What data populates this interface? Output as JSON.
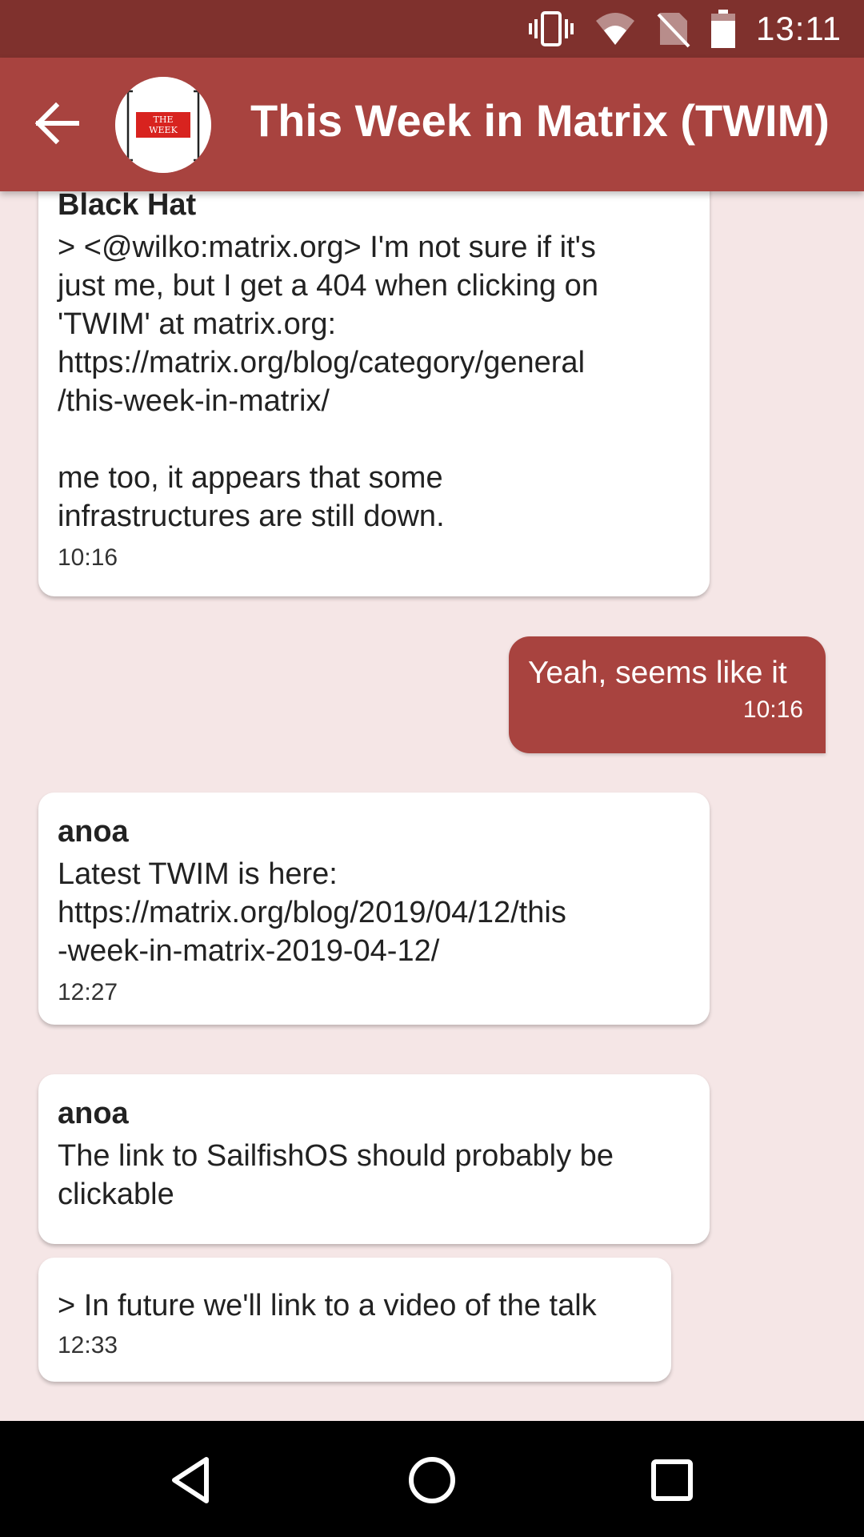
{
  "status_bar": {
    "time": "13:11",
    "icons": [
      "vibrate-icon",
      "wifi-icon",
      "no-sim-icon",
      "battery-icon"
    ]
  },
  "app_bar": {
    "title": "This Week in Matrix (TWIM)",
    "avatar_text_line1": "THE",
    "avatar_text_line2": "WEEK",
    "back_icon": "arrow-back-icon"
  },
  "messages": [
    {
      "sender": "Black Hat",
      "text": "> <@wilko:matrix.org> I'm not sure if it's\njust me, but I get a 404 when clicking on\n'TWIM' at matrix.org:\nhttps://matrix.org/blog/category/general\n/this-week-in-matrix/\n\nme too, it appears that some\ninfrastructures are still down.",
      "time": "10:16"
    },
    {
      "own": true,
      "text": "Yeah, seems like it",
      "time": "10:16"
    },
    {
      "sender": "anoa",
      "text": "Latest TWIM is here:\nhttps://matrix.org/blog/2019/04/12/this\n-week-in-matrix-2019-04-12/",
      "time": "12:27"
    },
    {
      "sender": "anoa",
      "text": "The link to SailfishOS should probably be\nclickable"
    },
    {
      "text": "> In future we'll link to a video of the talk",
      "time": "12:33"
    }
  ],
  "colors": {
    "status_bar": "#7f312d",
    "app_bar": "#a8433f",
    "background": "#f5e6e6",
    "own_bubble": "#a8433f",
    "other_bubble": "#ffffff"
  },
  "nav_bar": {
    "icons": [
      "back-triangle-icon",
      "home-circle-icon",
      "recents-square-icon"
    ]
  }
}
